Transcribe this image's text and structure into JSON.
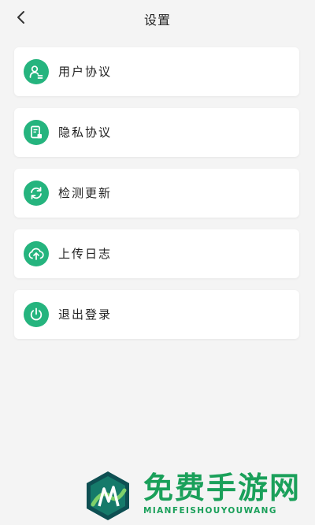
{
  "header": {
    "title": "设置"
  },
  "menu": {
    "items": [
      {
        "label": "用户协议",
        "icon": "user-agreement-icon"
      },
      {
        "label": "隐私协议",
        "icon": "privacy-document-icon"
      },
      {
        "label": "检测更新",
        "icon": "refresh-icon"
      },
      {
        "label": "上传日志",
        "icon": "cloud-upload-icon"
      },
      {
        "label": "退出登录",
        "icon": "power-icon"
      }
    ]
  },
  "watermark": {
    "title": "免费手游网",
    "subtitle": "MIANFEISHOUYOUWANG"
  },
  "colors": {
    "accent": "#25b47e",
    "background": "#f4f4f4",
    "watermark": "#1aa05a"
  }
}
